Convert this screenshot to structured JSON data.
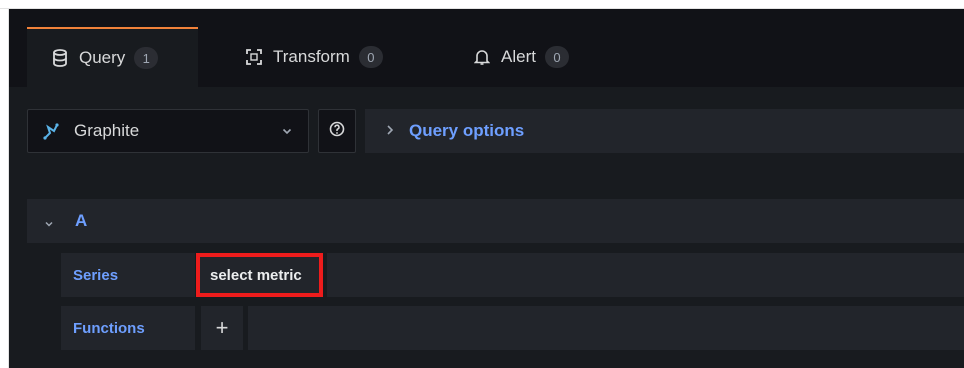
{
  "tabs": [
    {
      "label": "Query",
      "count": "1",
      "icon": "database-icon"
    },
    {
      "label": "Transform",
      "count": "0",
      "icon": "transform-icon"
    },
    {
      "label": "Alert",
      "count": "0",
      "icon": "bell-icon"
    }
  ],
  "datasource": {
    "name": "Graphite",
    "icon": "graphite-icon"
  },
  "query_options_label": "Query options",
  "query": {
    "ref_id": "A",
    "series_label": "Series",
    "series_value": "select metric",
    "functions_label": "Functions",
    "add_function_symbol": "+"
  },
  "colors": {
    "accent_tab": "#f2823a",
    "link": "#6e9fff",
    "highlight_box": "#ee1c1c",
    "panel": "#181b1f",
    "row": "#22252b"
  }
}
